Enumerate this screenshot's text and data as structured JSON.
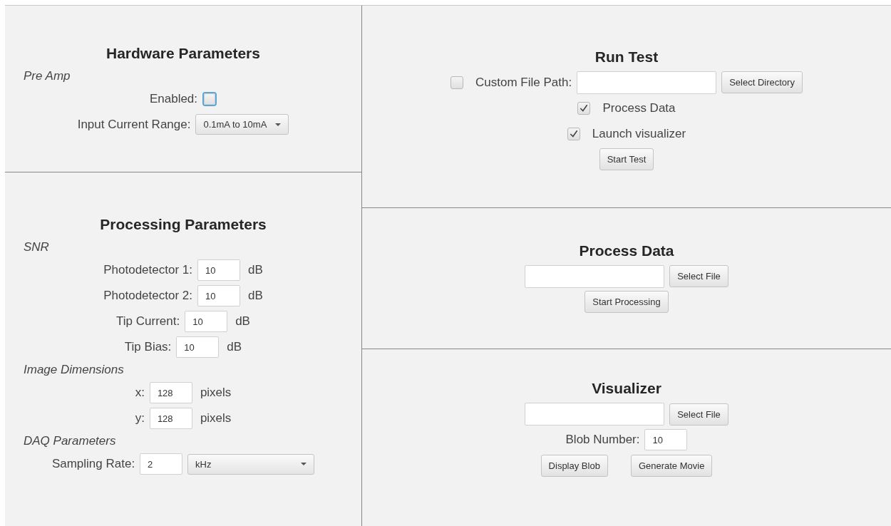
{
  "hardware": {
    "title": "Hardware Parameters",
    "groups": [
      {
        "heading": "Pre Amp",
        "rows": [
          {
            "kind": "checkbox",
            "label": "Enabled:",
            "checked": false,
            "focused": true
          },
          {
            "kind": "dropdown",
            "label": "Input Current Range:",
            "value": "0.1mA to 10mA"
          }
        ]
      }
    ]
  },
  "processing": {
    "title": "Processing Parameters",
    "groups": [
      {
        "heading": "SNR",
        "rows": [
          {
            "kind": "number",
            "label": "Photodetector 1:",
            "value": "10",
            "unit": "dB"
          },
          {
            "kind": "number",
            "label": "Photodetector 2:",
            "value": "10",
            "unit": "dB"
          },
          {
            "kind": "number",
            "label": "Tip Current:",
            "value": "10",
            "unit": "dB"
          },
          {
            "kind": "number",
            "label": "Tip Bias:",
            "value": "10",
            "unit": "dB"
          }
        ]
      },
      {
        "heading": "Image Dimensions",
        "rows": [
          {
            "kind": "number",
            "label": "x:",
            "value": "128",
            "unit": "pixels"
          },
          {
            "kind": "number",
            "label": "y:",
            "value": "128",
            "unit": "pixels"
          }
        ]
      },
      {
        "heading": "DAQ Parameters",
        "rows": [
          {
            "kind": "number_dropdown",
            "label": "Sampling Rate:",
            "value": "2",
            "option": "kHz"
          }
        ]
      }
    ]
  },
  "run_test": {
    "title": "Run Test",
    "custom_path": {
      "checked": false,
      "label": "Custom File Path:",
      "button": "Select Directory"
    },
    "options": [
      {
        "label": "Process Data",
        "checked": true
      },
      {
        "label": "Launch visualizer",
        "checked": true
      }
    ],
    "button": "Start Test"
  },
  "process_data": {
    "title": "Process Data",
    "file_button": "Select File",
    "button": "Start Processing"
  },
  "visualizer": {
    "title": "Visualizer",
    "file_button": "Select File",
    "blob_label": "Blob Number:",
    "blob_value": "10",
    "buttons": [
      "Display Blob",
      "Generate Movie"
    ]
  }
}
